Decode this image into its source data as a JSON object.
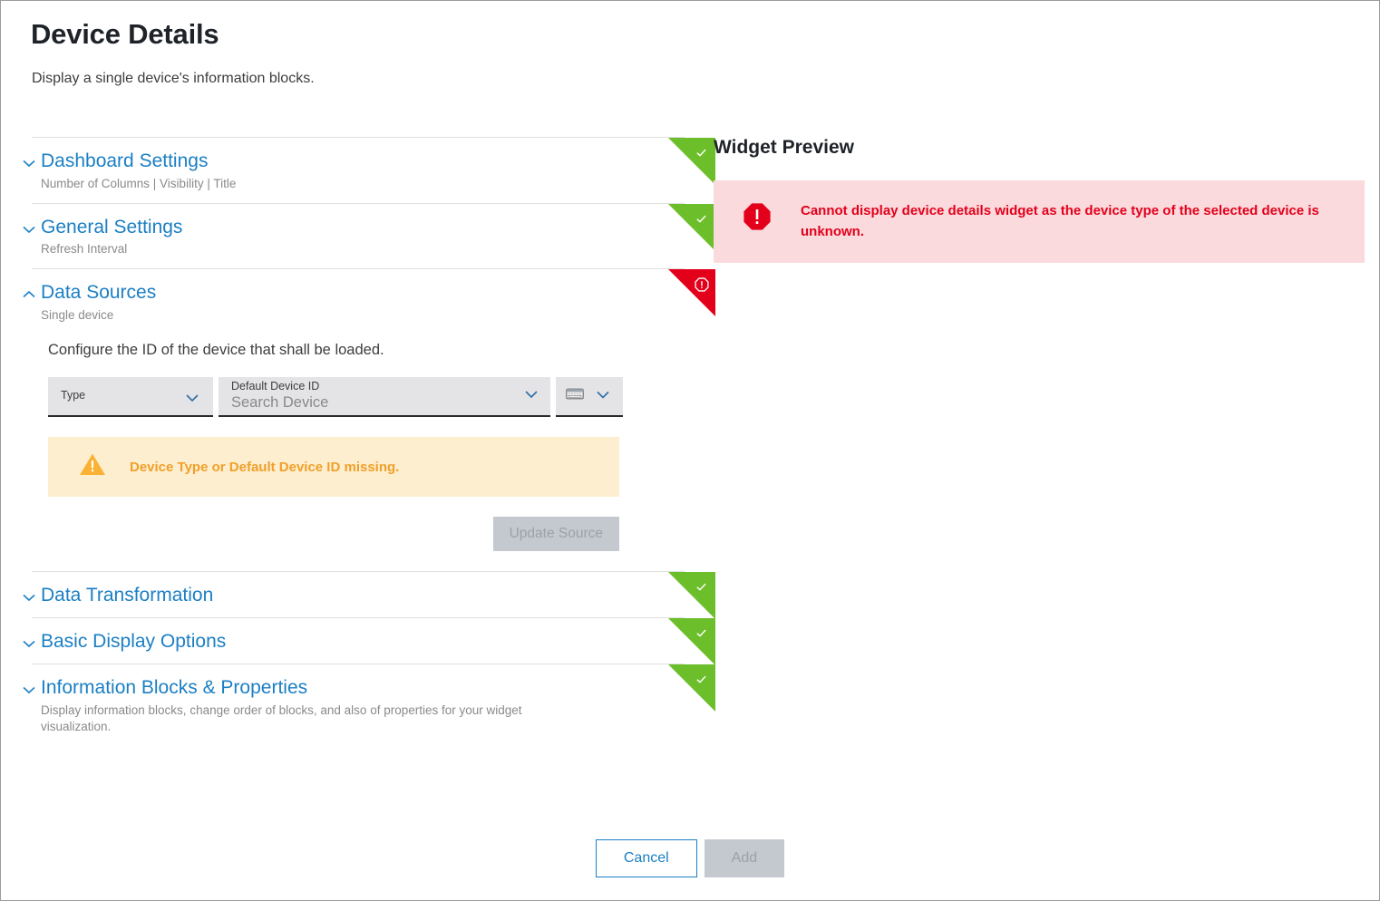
{
  "header": {
    "title": "Device Details",
    "subtitle": "Display a single device's information blocks."
  },
  "accordions": [
    {
      "title": "Dashboard Settings",
      "subtitle": "Number of Columns | Visibility | Title",
      "status": "ok",
      "expanded": false,
      "chevron": "chevron-down-icon"
    },
    {
      "title": "General Settings",
      "subtitle": "Refresh Interval",
      "status": "ok",
      "expanded": false,
      "chevron": "chevron-down-icon"
    },
    {
      "title": "Data Sources",
      "subtitle": "Single device",
      "status": "error",
      "expanded": true,
      "chevron": "chevron-up-icon"
    },
    {
      "title": "Data Transformation",
      "subtitle": "",
      "status": "ok",
      "expanded": false,
      "chevron": "chevron-down-icon"
    },
    {
      "title": "Basic Display Options",
      "subtitle": "",
      "status": "ok",
      "expanded": false,
      "chevron": "chevron-down-icon"
    },
    {
      "title": "Information Blocks & Properties",
      "subtitle": "Display information blocks, change order of blocks, and also of properties for your widget visualization.",
      "status": "ok",
      "expanded": false,
      "chevron": "chevron-down-icon"
    }
  ],
  "data_sources": {
    "instruction": "Configure the ID of the device that shall be loaded.",
    "type_field": {
      "label": "Type",
      "value": "",
      "caret": "chevron-down-icon"
    },
    "device_field": {
      "label": "Default Device ID",
      "placeholder": "Search Device",
      "value": "",
      "caret": "chevron-down-icon"
    },
    "keyboard_field": {
      "icon": "keyboard-icon",
      "caret": "chevron-down-icon"
    },
    "warning": {
      "icon": "warning-triangle-icon",
      "text": "Device Type or Default Device ID missing."
    },
    "update_button": "Update Source"
  },
  "preview": {
    "title": "Widget Preview",
    "error": {
      "icon": "error-octagon-icon",
      "text": "Cannot display device details widget as the device type of the selected device is unknown."
    }
  },
  "footer": {
    "cancel_label": "Cancel",
    "add_label": "Add"
  },
  "colors": {
    "link_blue": "#1b7fc4",
    "status_ok_green": "#6cbe2a",
    "status_error_red": "#e3001b",
    "warning_amber": "#f0a02a",
    "warning_bg": "#fdeecf",
    "error_bg": "#fadadd",
    "field_bg": "#e4e4e7",
    "disabled_btn_bg": "#c4c9cf"
  }
}
